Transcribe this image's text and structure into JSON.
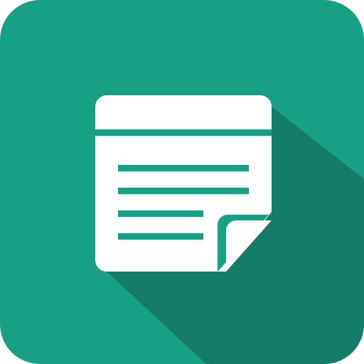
{
  "icon": {
    "name": "sticky-note-icon",
    "colors": {
      "background": "#18A085",
      "shadow": "#157C68",
      "note": "#FFFFFF",
      "lines": "#18A085"
    }
  }
}
